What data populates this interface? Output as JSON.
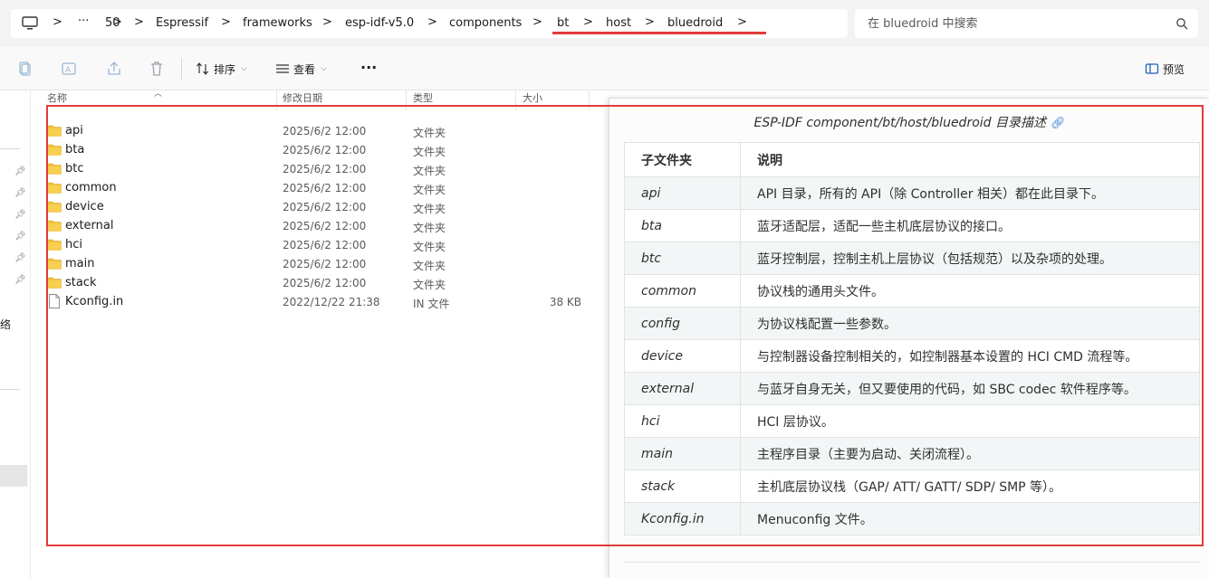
{
  "address_bar": {
    "more_label": "···",
    "crumbs": [
      "50",
      "Espressif",
      "frameworks",
      "esp-idf-v5.0",
      "components",
      "bt",
      "host",
      "bluedroid"
    ],
    "separator": ">"
  },
  "search": {
    "placeholder": "在 bluedroid 中搜索"
  },
  "toolbar": {
    "sort_label": "排序",
    "view_label": "查看",
    "more_label": "···",
    "preview_label": "预览"
  },
  "nav": {
    "fragment_text": "络"
  },
  "file_list": {
    "columns": {
      "name": "名称",
      "date": "修改日期",
      "type": "类型",
      "size": "大小"
    },
    "rows": [
      {
        "name": "api",
        "date": "2025/6/2 12:00",
        "type": "文件夹",
        "size": "",
        "kind": "folder"
      },
      {
        "name": "bta",
        "date": "2025/6/2 12:00",
        "type": "文件夹",
        "size": "",
        "kind": "folder"
      },
      {
        "name": "btc",
        "date": "2025/6/2 12:00",
        "type": "文件夹",
        "size": "",
        "kind": "folder"
      },
      {
        "name": "common",
        "date": "2025/6/2 12:00",
        "type": "文件夹",
        "size": "",
        "kind": "folder"
      },
      {
        "name": "device",
        "date": "2025/6/2 12:00",
        "type": "文件夹",
        "size": "",
        "kind": "folder"
      },
      {
        "name": "external",
        "date": "2025/6/2 12:00",
        "type": "文件夹",
        "size": "",
        "kind": "folder"
      },
      {
        "name": "hci",
        "date": "2025/6/2 12:00",
        "type": "文件夹",
        "size": "",
        "kind": "folder"
      },
      {
        "name": "main",
        "date": "2025/6/2 12:00",
        "type": "文件夹",
        "size": "",
        "kind": "folder"
      },
      {
        "name": "stack",
        "date": "2025/6/2 12:00",
        "type": "文件夹",
        "size": "",
        "kind": "folder"
      },
      {
        "name": "Kconfig.in",
        "date": "2022/12/22 21:38",
        "type": "IN 文件",
        "size": "38 KB",
        "kind": "file"
      }
    ]
  },
  "doc_panel": {
    "title": "ESP-IDF component/bt/host/bluedroid 目录描述",
    "headers": {
      "sub": "子文件夹",
      "desc": "说明"
    },
    "rows": [
      {
        "sub": "api",
        "desc": "API 目录，所有的 API（除 Controller 相关）都在此目录下。"
      },
      {
        "sub": "bta",
        "desc": "蓝牙适配层，适配一些主机底层协议的接口。"
      },
      {
        "sub": "btc",
        "desc": "蓝牙控制层，控制主机上层协议（包括规范）以及杂项的处理。"
      },
      {
        "sub": "common",
        "desc": "协议栈的通用头文件。"
      },
      {
        "sub": "config",
        "desc": "为协议栈配置一些参数。"
      },
      {
        "sub": "device",
        "desc": "与控制器设备控制相关的，如控制器基本设置的 HCI CMD 流程等。"
      },
      {
        "sub": "external",
        "desc": "与蓝牙自身无关，但又要使用的代码，如 SBC codec 软件程序等。"
      },
      {
        "sub": "hci",
        "desc": "HCI 层协议。"
      },
      {
        "sub": "main",
        "desc": "主程序目录（主要为启动、关闭流程）。"
      },
      {
        "sub": "stack",
        "desc": "主机底层协议栈（GAP/ ATT/ GATT/ SDP/ SMP 等）。"
      },
      {
        "sub": "Kconfig.in",
        "desc": "Menuconfig 文件。"
      }
    ]
  },
  "colors": {
    "highlight": "#e23b3b",
    "folder": "#f3c13a",
    "link": "#2f7fd1"
  }
}
